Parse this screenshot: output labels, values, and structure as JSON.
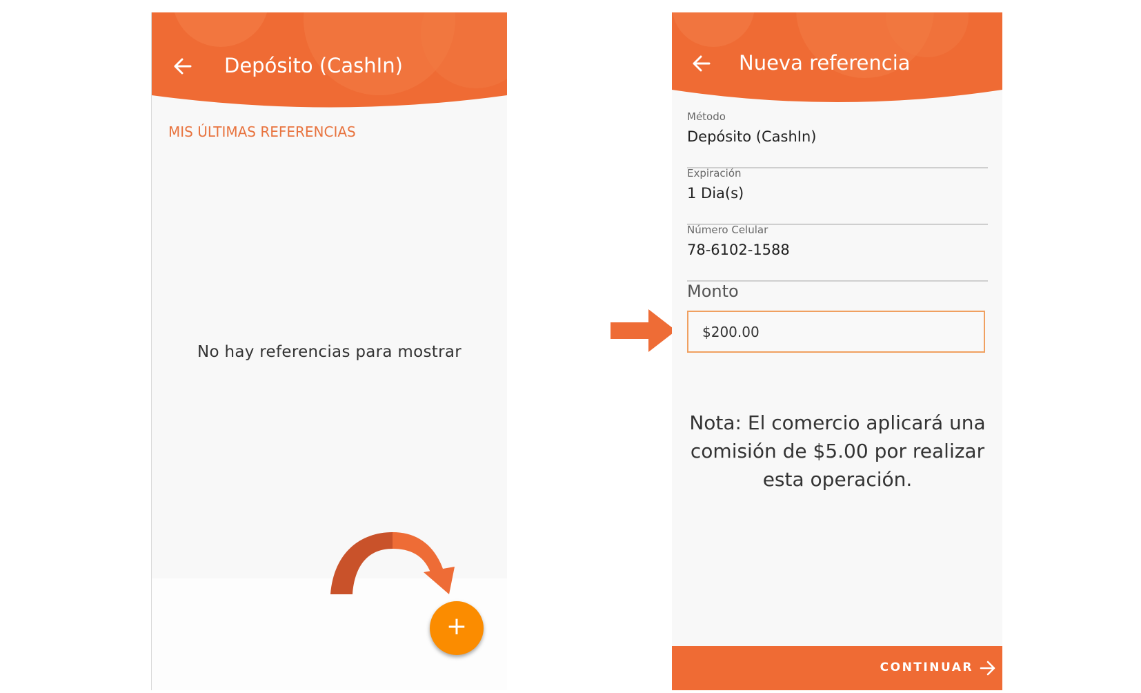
{
  "screen_left": {
    "header": {
      "title": "Depósito (CashIn)",
      "back_icon": "arrow-left-icon"
    },
    "section_label": "MIS ÚLTIMAS REFERENCIAS",
    "empty_message": "No hay referencias para mostrar",
    "fab": {
      "icon": "plus-icon",
      "symbol": "+"
    }
  },
  "screen_right": {
    "header": {
      "title": "Nueva referencia",
      "back_icon": "arrow-left-icon"
    },
    "fields": [
      {
        "label": "Método",
        "value": "Depósito (CashIn)"
      },
      {
        "label": "Expiración",
        "value": "1 Dia(s)"
      },
      {
        "label": "Número Celular",
        "value": "78-6102-1588"
      }
    ],
    "amount": {
      "label": "Monto",
      "value": "$200.00"
    },
    "note": "Nota: El comercio aplicará una comisión de $5.00 por realizar esta operación.",
    "continue_button": {
      "label": "CONTINUAR",
      "icon": "arrow-right-icon"
    }
  },
  "annotations": {
    "curved_arrow_icon": "curved-arrow-icon",
    "pointer_arrow_icon": "pointer-arrow-icon"
  },
  "colors": {
    "header_orange": "#ef6b34",
    "header_orange_light": "#f5884f",
    "accent_text": "#e8733e",
    "fab_orange": "#fb8c00",
    "annotation_arrow": "#ee6c36",
    "annotation_arrow_dark": "#c9522a"
  }
}
